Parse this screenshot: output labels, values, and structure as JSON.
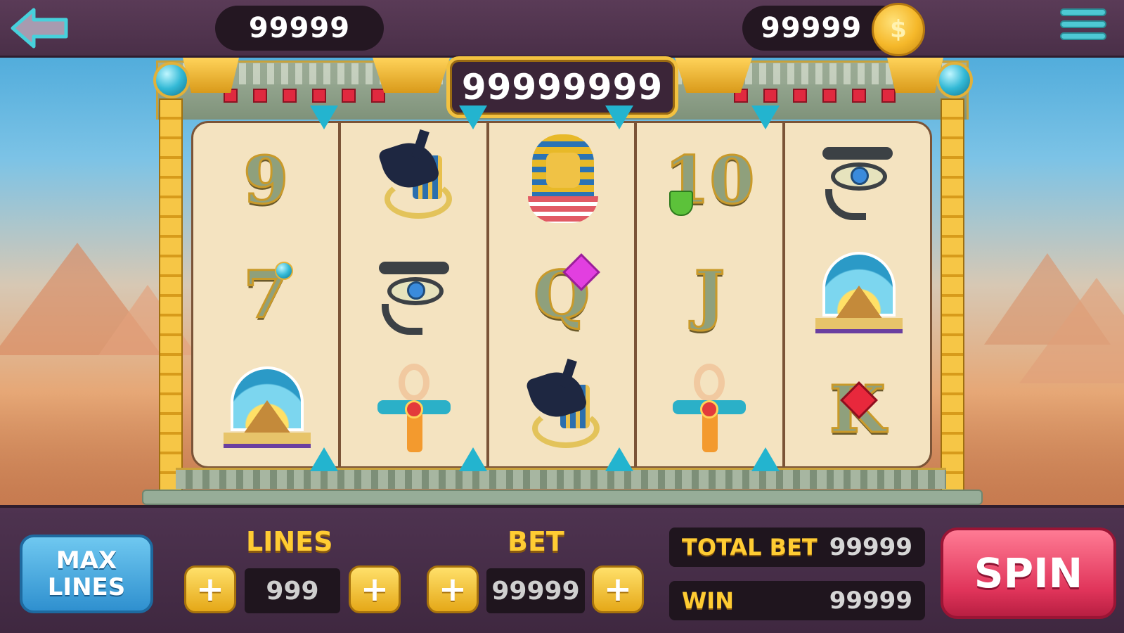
{
  "header": {
    "left_balance": "99999",
    "coin_balance": "99999",
    "coin_symbol": "$"
  },
  "jackpot": "99999999",
  "reels": [
    [
      "9",
      "7",
      "pyramids"
    ],
    [
      "anubis",
      "eye-of-horus",
      "ankh"
    ],
    [
      "pharaoh",
      "Q",
      "anubis"
    ],
    [
      "10",
      "J",
      "ankh"
    ],
    [
      "eye-of-horus",
      "pyramids",
      "K"
    ]
  ],
  "symbol_letters": {
    "nine": "9",
    "seven": "7",
    "queen": "Q",
    "ten": "10",
    "jack": "J",
    "king": "K"
  },
  "controls": {
    "max_lines_line1": "MAX",
    "max_lines_line2": "LINES",
    "lines_label": "LINES",
    "lines_value": "999",
    "bet_label": "BET",
    "bet_value": "99999",
    "plus": "+",
    "total_bet_label": "TOTAL BET",
    "total_bet_value": "99999",
    "win_label": "WIN",
    "win_value": "99999",
    "spin_label": "SPIN"
  },
  "colors": {
    "accent_gold": "#ffcc33",
    "spin_red": "#e0345a",
    "max_lines_blue": "#2f90cf",
    "frame_teal": "#23b4cf"
  }
}
